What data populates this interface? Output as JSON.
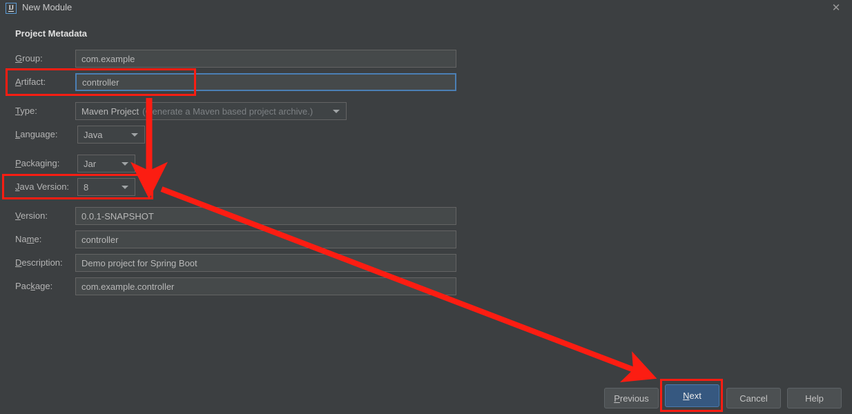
{
  "window": {
    "title": "New Module",
    "app_icon": "intellij-idea-icon",
    "close_icon": "close-icon"
  },
  "section": {
    "title": "Project Metadata"
  },
  "form": {
    "fields": [
      {
        "id": "group",
        "label": "Group:",
        "mnemonic": "G",
        "label_rest": "roup:",
        "kind": "text",
        "value": "com.example"
      },
      {
        "id": "artifact",
        "label": "Artifact:",
        "mnemonic": "A",
        "label_rest": "rtifact:",
        "kind": "text",
        "value": "controller",
        "focused": true
      },
      {
        "id": "type",
        "label": "Type:",
        "mnemonic": "T",
        "label_rest": "ype:",
        "kind": "combo",
        "value": "Maven Project",
        "hint": "(Generate a Maven based project archive.)"
      },
      {
        "id": "language",
        "label": "Language:",
        "mnemonic": "L",
        "label_rest": "anguage:",
        "kind": "combo",
        "value": "Java"
      },
      {
        "id": "packaging",
        "label": "Packaging:",
        "mnemonic": "P",
        "label_rest": "ackaging:",
        "kind": "combo",
        "value": "Jar"
      },
      {
        "id": "java-version",
        "label": "Java Version:",
        "mnemonic": "J",
        "label_rest": "ava Version:",
        "kind": "combo",
        "value": "8"
      },
      {
        "id": "version",
        "label": "Version:",
        "mnemonic": "V",
        "label_rest": "ersion:",
        "kind": "text",
        "value": "0.0.1-SNAPSHOT"
      },
      {
        "id": "name",
        "label": "Name:",
        "mnemonic": "m",
        "label_rest": "e:",
        "label_pre": "Na",
        "kind": "text",
        "value": "controller"
      },
      {
        "id": "description",
        "label": "Description:",
        "mnemonic": "D",
        "label_rest": "escription:",
        "kind": "text",
        "value": "Demo project for Spring Boot"
      },
      {
        "id": "package",
        "label": "Package:",
        "mnemonic": "k",
        "label_pre": "Pac",
        "label_rest": "age:",
        "kind": "text",
        "value": "com.example.controller"
      }
    ]
  },
  "buttons": {
    "previous": {
      "label": "Previous",
      "mnemonic": "P",
      "rest": "revious"
    },
    "next": {
      "label": "Next",
      "mnemonic": "N",
      "rest": "ext",
      "primary": true
    },
    "cancel": {
      "label": "Cancel"
    },
    "help": {
      "label": "Help"
    }
  },
  "annotations": {
    "color": "#fc1d12",
    "boxes": [
      {
        "name": "artifact-highlight-box"
      },
      {
        "name": "java-version-highlight-box"
      },
      {
        "name": "next-button-highlight-box"
      }
    ],
    "arrows": [
      {
        "name": "arrow-down-to-java-version"
      },
      {
        "name": "arrow-diagonal-to-next-button"
      }
    ]
  }
}
